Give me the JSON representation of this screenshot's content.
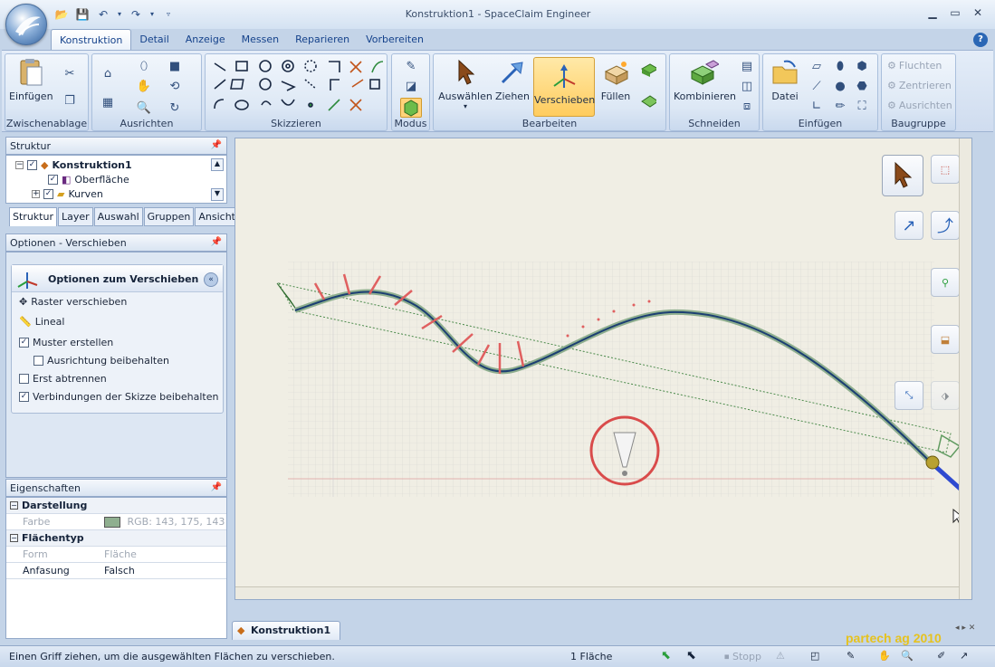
{
  "window": {
    "title": "Konstruktion1 - SpaceClaim Engineer"
  },
  "tabs": [
    "Konstruktion",
    "Detail",
    "Anzeige",
    "Messen",
    "Reparieren",
    "Vorbereiten"
  ],
  "ribbon": {
    "zwischenablage": {
      "label": "Zwischenablage",
      "einfuegen": "Einfügen"
    },
    "ausrichten": {
      "label": "Ausrichten"
    },
    "skizzieren": {
      "label": "Skizzieren"
    },
    "modus": {
      "label": "Modus"
    },
    "bearbeiten": {
      "label": "Bearbeiten",
      "auswaehlen": "Auswählen",
      "ziehen": "Ziehen",
      "verschieben": "Verschieben",
      "fuellen": "Füllen"
    },
    "schneiden": {
      "label": "Schneiden",
      "kombinieren": "Kombinieren"
    },
    "einfuegen": {
      "label": "Einfügen",
      "datei": "Datei"
    },
    "baugruppe": {
      "label": "Baugruppe",
      "fluchten": "Fluchten",
      "zentrieren": "Zentrieren",
      "ausrichten": "Ausrichten"
    }
  },
  "struktur": {
    "header": "Struktur",
    "items": [
      "Konstruktion1",
      "Oberfläche",
      "Kurven"
    ],
    "tabs": [
      "Struktur",
      "Layer",
      "Auswahl",
      "Gruppen",
      "Ansichten"
    ]
  },
  "optionen": {
    "header": "Optionen - Verschieben",
    "title": "Optionen zum Verschieben",
    "raster": "Raster verschieben",
    "lineal": "Lineal",
    "muster": "Muster erstellen",
    "ausrichtung": "Ausrichtung beibehalten",
    "abtrennen": "Erst abtrennen",
    "verbindungen": "Verbindungen der Skizze beibehalten"
  },
  "eigenschaften": {
    "header": "Eigenschaften",
    "darstellung": "Darstellung",
    "farbe_label": "Farbe",
    "farbe_value": "RGB: 143, 175, 143",
    "flaechentyp": "Flächentyp",
    "form_label": "Form",
    "form_value": "Fläche",
    "anfasung_label": "Anfasung",
    "anfasung_value": "Falsch"
  },
  "doc_tab": "Konstruktion1",
  "status": {
    "hint": "Einen Griff ziehen, um die ausgewählten Flächen zu verschieben.",
    "selection": "1 Fläche",
    "stop": "Stopp"
  },
  "watermark": "partech ag 2010",
  "colors": {
    "accent": "#2b5aa8",
    "surface": "#8faf8f",
    "warning": "#d9534f",
    "curve": "#1c3f72"
  }
}
